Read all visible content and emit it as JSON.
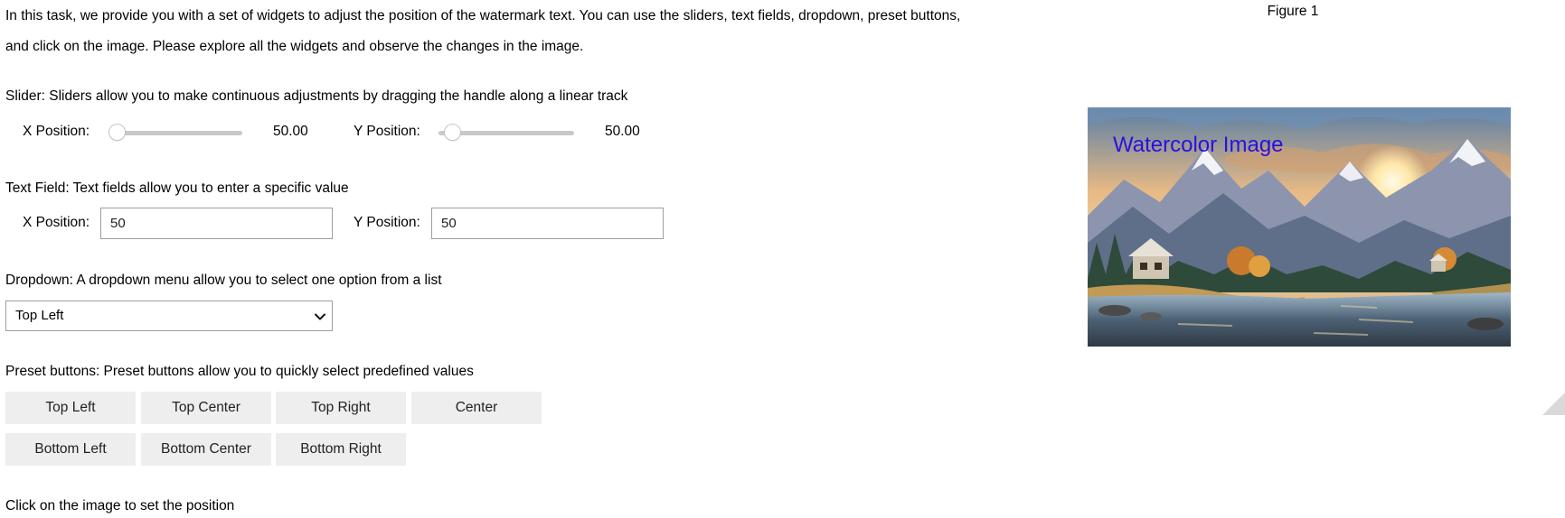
{
  "intro": "In this task, we provide you with a set of widgets to adjust the position of the watermark text. You can use the sliders, text fields, dropdown, preset buttons, and click on the image. Please explore all the widgets and observe the changes in the image.",
  "slider_section": {
    "description": "Slider: Sliders allow you to make continuous adjustments by dragging the handle along a linear track",
    "x": {
      "label": "X Position:",
      "value": "50.00",
      "fraction": 0.0
    },
    "y": {
      "label": "Y Position:",
      "value": "50.00",
      "fraction": 0.07
    }
  },
  "textfield_section": {
    "description": "Text Field: Text fields allow you to enter a specific value",
    "x": {
      "label": "X Position:",
      "value": "50"
    },
    "y": {
      "label": "Y Position:",
      "value": "50"
    }
  },
  "dropdown_section": {
    "description": "Dropdown: A dropdown menu allow you to select one option from a list",
    "selected": "Top Left"
  },
  "preset_section": {
    "description": "Preset buttons: Preset buttons allow you to quickly select predefined values",
    "row1": [
      "Top Left",
      "Top Center",
      "Top Right",
      "Center"
    ],
    "row2": [
      "Bottom Left",
      "Bottom Center",
      "Bottom Right"
    ]
  },
  "click_section": {
    "description": "Click on the image to set the position"
  },
  "figure": {
    "title": "Figure 1",
    "watermark": "Watercolor Image",
    "watermark_color": "#2a10e0"
  },
  "icons": {
    "dropdown": "chevron-down-icon",
    "resize": "resize-handle-icon"
  }
}
